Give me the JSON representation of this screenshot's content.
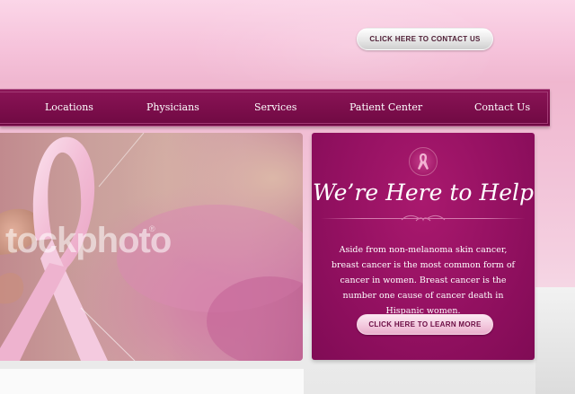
{
  "header": {
    "contact_button_label": "CLICK HERE TO CONTACT US"
  },
  "nav": {
    "items": [
      {
        "label": "Locations"
      },
      {
        "label": "Physicians"
      },
      {
        "label": "Services"
      },
      {
        "label": "Patient Center"
      },
      {
        "label": "Contact Us"
      }
    ]
  },
  "hero": {
    "watermark": "tockphoto",
    "watermark_mark": "®",
    "icon": "pink-ribbon"
  },
  "help": {
    "icon": "pink-ribbon-icon",
    "title": "We’re Here to Help",
    "body": "Aside from non-melanoma skin cancer, breast cancer is the most common form of cancer in women. Breast cancer is the number one cause of cancer death in Hispanic women.",
    "learn_button_label": "CLICK HERE TO LEARN MORE"
  },
  "colors": {
    "brand_magenta": "#8a1456",
    "light_pink": "#f6c3db",
    "white": "#ffffff"
  }
}
